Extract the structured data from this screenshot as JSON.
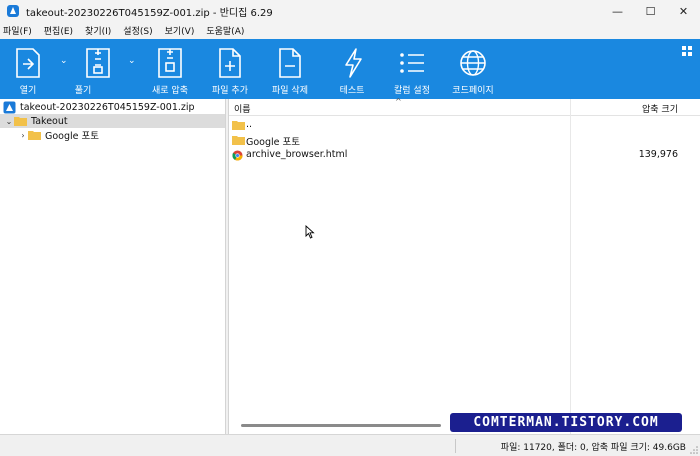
{
  "window": {
    "title": "takeout-20230226T045159Z-001.zip - 반디집 6.29",
    "minimize": "—",
    "maximize": "☐",
    "close": "✕"
  },
  "menu": [
    "파일(F)",
    "편집(E)",
    "찾기(I)",
    "설정(S)",
    "보기(V)",
    "도움말(A)"
  ],
  "toolbar": {
    "open": "열기",
    "extract": "풀기",
    "new_archive": "새로 압축",
    "add_file": "파일 추가",
    "delete_file": "파일 삭제",
    "test": "테스트",
    "column_settings": "칼럼 설정",
    "codepage": "코드페이지"
  },
  "tree": {
    "archive": "takeout-20230226T045159Z-001.zip",
    "takeout": "Takeout",
    "google_photos": "Google 포토"
  },
  "list": {
    "col_name": "이름",
    "col_size": "압축 크기",
    "rows": [
      {
        "name": "..",
        "size": ""
      },
      {
        "name": "Google 포토",
        "size": ""
      },
      {
        "name": "archive_browser.html",
        "size": "139,976"
      }
    ]
  },
  "watermark": "COMTERMAN.TISTORY.COM",
  "status": "파일: 11720, 폴더: 0, 압축 파일 크기: 49.6GB",
  "colors": {
    "toolbar_bg": "#1a88e0",
    "folder": "#f2c14a",
    "watermark_bg": "#1b1f8f"
  }
}
